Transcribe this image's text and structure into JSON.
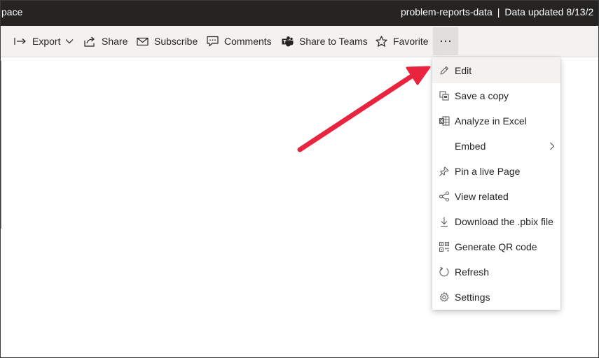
{
  "window": {
    "left_title": "pace",
    "report_name": "problem-reports-data",
    "separator": "|",
    "data_updated": "Data updated 8/13/2"
  },
  "toolbar": {
    "export": "Export",
    "share": "Share",
    "subscribe": "Subscribe",
    "comments": "Comments",
    "share_to_teams": "Share to Teams",
    "favorite": "Favorite",
    "more": "···"
  },
  "menu": {
    "items": [
      {
        "label": "Edit",
        "icon": "pencil-icon"
      },
      {
        "label": "Save a copy",
        "icon": "copy-icon"
      },
      {
        "label": "Analyze in Excel",
        "icon": "excel-icon"
      },
      {
        "label": "Embed",
        "icon": "none",
        "submenu": true
      },
      {
        "label": "Pin a live Page",
        "icon": "pin-icon"
      },
      {
        "label": "View related",
        "icon": "related-icon"
      },
      {
        "label": "Download the .pbix file",
        "icon": "download-icon"
      },
      {
        "label": "Generate QR code",
        "icon": "qr-code-icon"
      },
      {
        "label": "Refresh",
        "icon": "refresh-icon"
      },
      {
        "label": "Settings",
        "icon": "settings-icon"
      }
    ]
  },
  "colors": {
    "title_bar": "#252423",
    "toolbar_bg": "#f3f2f1",
    "annotation_arrow": "#e8243f",
    "hover": "#f3f2f1"
  }
}
